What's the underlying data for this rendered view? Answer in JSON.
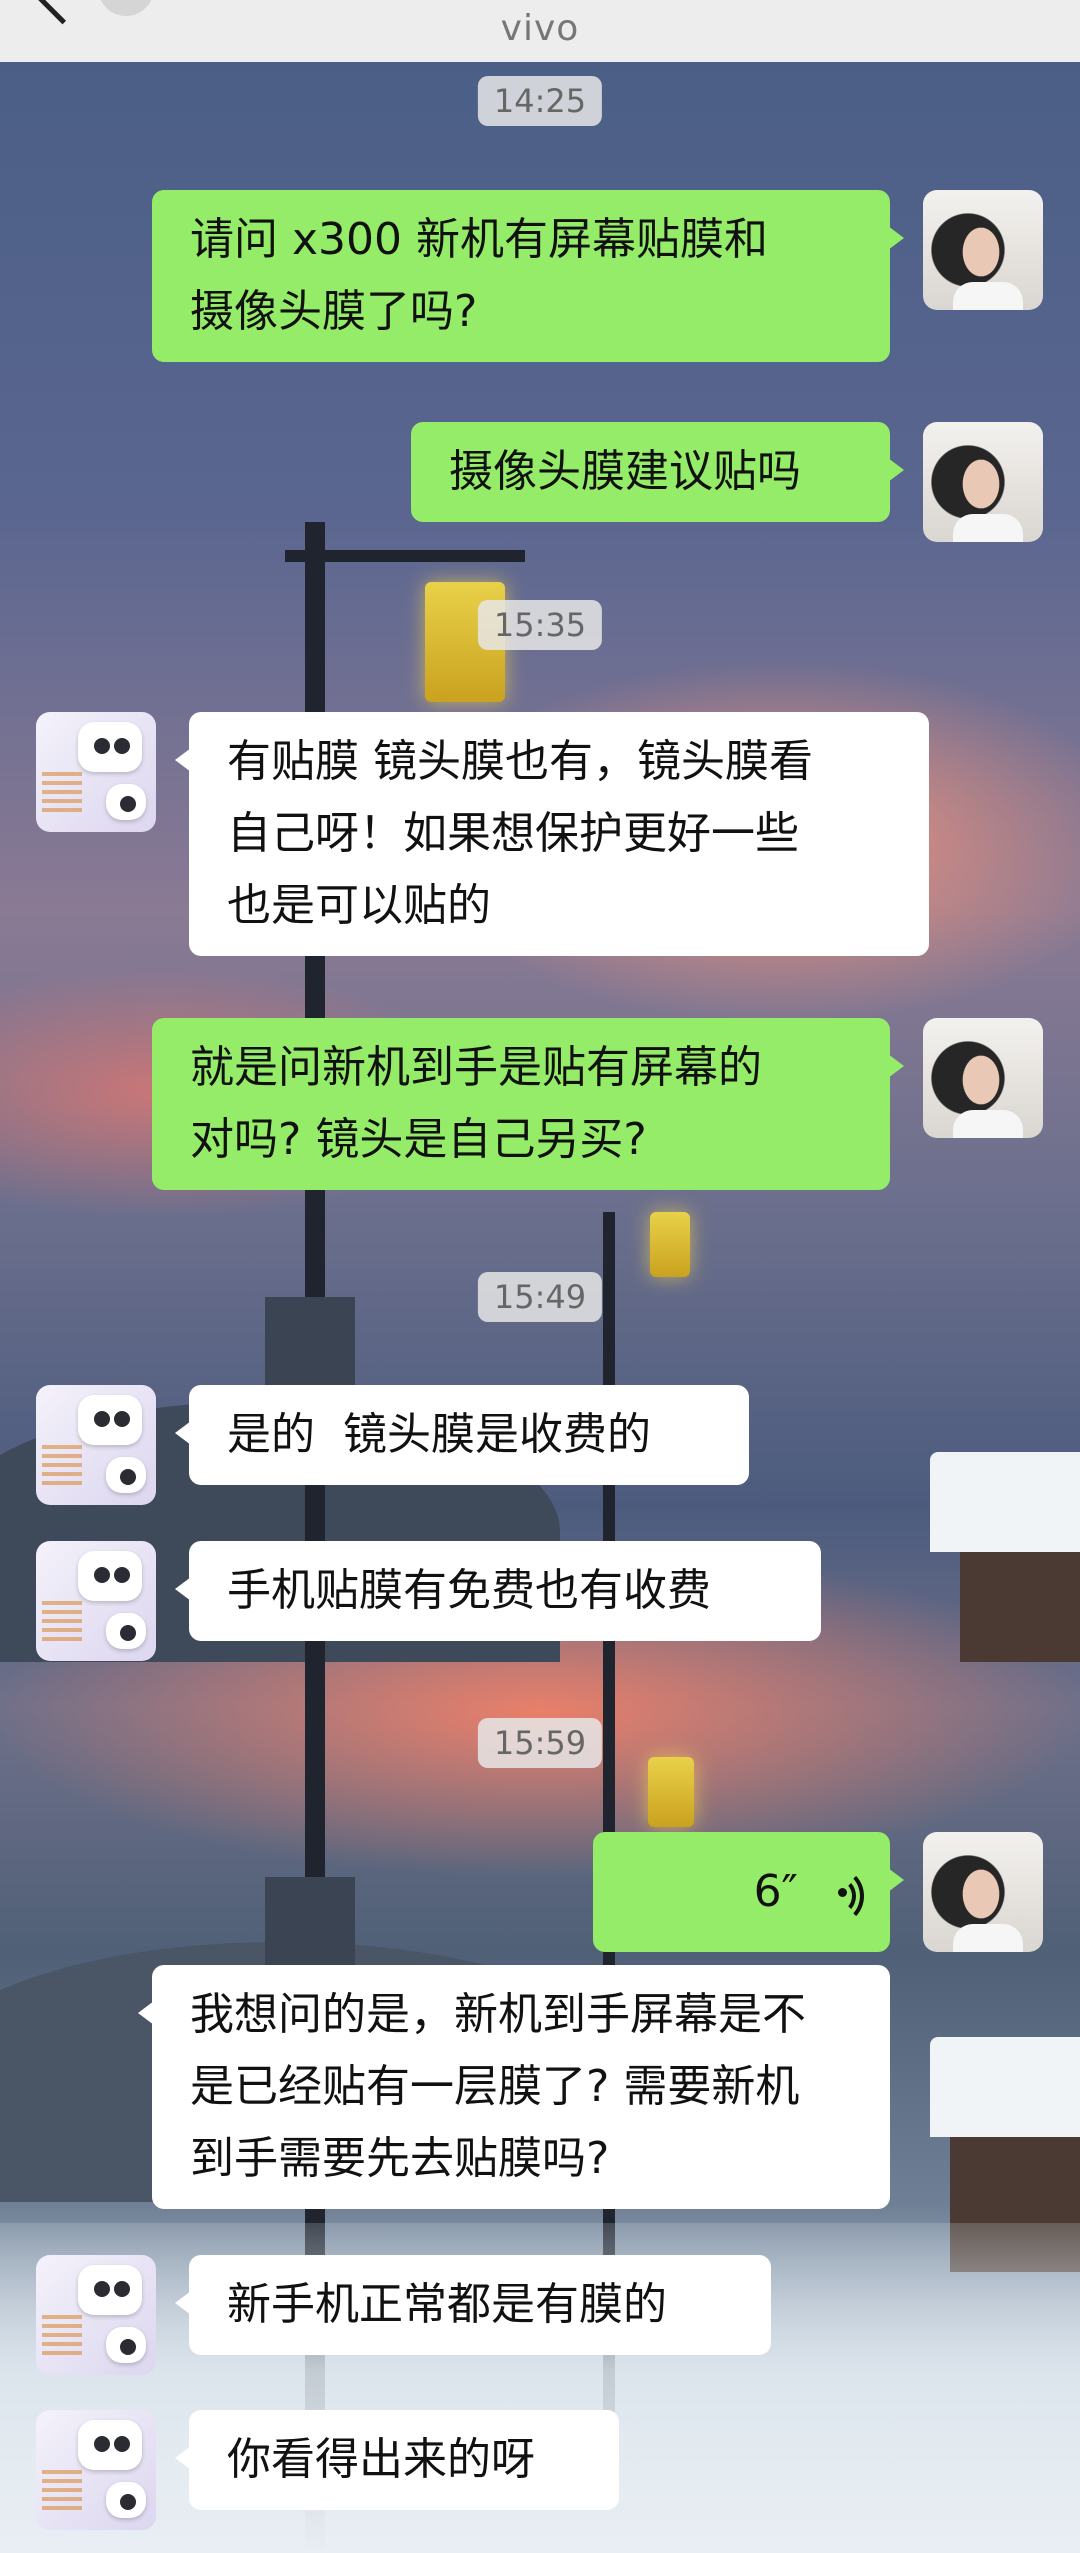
{
  "header": {
    "title": "vivo"
  },
  "timestamps": [
    "14:25",
    "15:35",
    "15:49",
    "15:59"
  ],
  "messages": [
    {
      "from": "me",
      "text": "请问 x300 新机有屏幕贴膜和\n摄像头膜了吗?"
    },
    {
      "from": "me",
      "text": "摄像头膜建议贴吗"
    },
    {
      "from": "them",
      "text": "有贴膜 镜头膜也有，镜头膜看\n自己呀！如果想保护更好一些\n也是可以贴的"
    },
    {
      "from": "me",
      "text": "就是问新机到手是贴有屏幕的\n对吗? 镜头是自己另买?"
    },
    {
      "from": "them",
      "text": "是的  镜头膜是收费的"
    },
    {
      "from": "them",
      "text": "手机贴膜有免费也有收费"
    },
    {
      "from": "me",
      "type": "voice",
      "duration": "6″"
    },
    {
      "from": "them",
      "text": "我想问的是，新机到手屏幕是不\n是已经贴有一层膜了? 需要新机\n到手需要先去贴膜吗?"
    },
    {
      "from": "them",
      "text": "新手机正常都是有膜的"
    },
    {
      "from": "them",
      "text": "你看得出来的呀"
    }
  ],
  "icons": {
    "back": "chevron-left-icon",
    "voice": "voice-wave-icon"
  },
  "colors": {
    "me_bubble": "#95ec69",
    "them_bubble": "#ffffff",
    "timestamp_bg": "#e6e6e6"
  }
}
